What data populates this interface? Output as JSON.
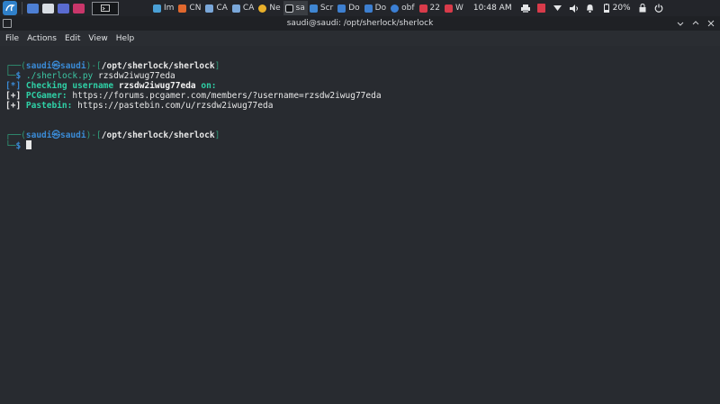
{
  "taskbar": {
    "tasks": [
      {
        "label": "Im",
        "icon": "image-icon",
        "color": "#4aa0d6"
      },
      {
        "label": "CN",
        "icon": "document-icon",
        "color": "#e0682e"
      },
      {
        "label": "CA",
        "icon": "document-icon",
        "color": "#7aa7d9"
      },
      {
        "label": "CA",
        "icon": "document-icon",
        "color": "#7aa7d9"
      },
      {
        "label": "Ne",
        "icon": "chrome-icon",
        "color": "#e9b02a"
      },
      {
        "label": "sa",
        "icon": "terminal-icon",
        "color": "#c9ccd0"
      },
      {
        "label": "Scr",
        "icon": "screenshot-icon",
        "color": "#3f86d2"
      },
      {
        "label": "Do",
        "icon": "folder-icon",
        "color": "#3d7fd0"
      },
      {
        "label": "Do",
        "icon": "folder-icon",
        "color": "#3d7fd0"
      },
      {
        "label": "obf",
        "icon": "firefox-icon",
        "color": "#3b7fd4"
      },
      {
        "label": "22",
        "icon": "pdf-icon",
        "color": "#d83b4a"
      },
      {
        "label": "W",
        "icon": "pdf-icon",
        "color": "#d83b4a"
      }
    ],
    "clock": "10:48 AM",
    "battery": "20%"
  },
  "window": {
    "title": "saudi@saudi: /opt/sherlock/sherlock"
  },
  "menu": [
    "File",
    "Actions",
    "Edit",
    "View",
    "Help"
  ],
  "terminal": {
    "prompt1": {
      "box_top": "┌──(",
      "user": "saudi㉿saudi",
      "box_mid": ")-[",
      "path": "/opt/sherlock/sherlock",
      "box_end": "]",
      "box_bottom": "└─",
      "dollar": "$ ",
      "command": "./sherlock.py",
      "argument": " rzsdw2iwug77eda"
    },
    "line_checking": {
      "bracket": "[*]",
      "text1": " Checking username ",
      "username": "rzsdw2iwug77eda",
      "text2": " on:"
    },
    "result1": {
      "bracket": "[+]",
      "site": " PCGamer:",
      "url": " https://forums.pcgamer.com/members/?username=rzsdw2iwug77eda"
    },
    "result2": {
      "bracket": "[+]",
      "site": " Pastebin:",
      "url": " https://pastebin.com/u/rzsdw2iwug77eda"
    },
    "prompt2": {
      "box_top": "┌──(",
      "user": "saudi㉿saudi",
      "box_mid": ")-[",
      "path": "/opt/sherlock/sherlock",
      "box_end": "]",
      "box_bottom": "└─",
      "dollar": "$ "
    }
  }
}
